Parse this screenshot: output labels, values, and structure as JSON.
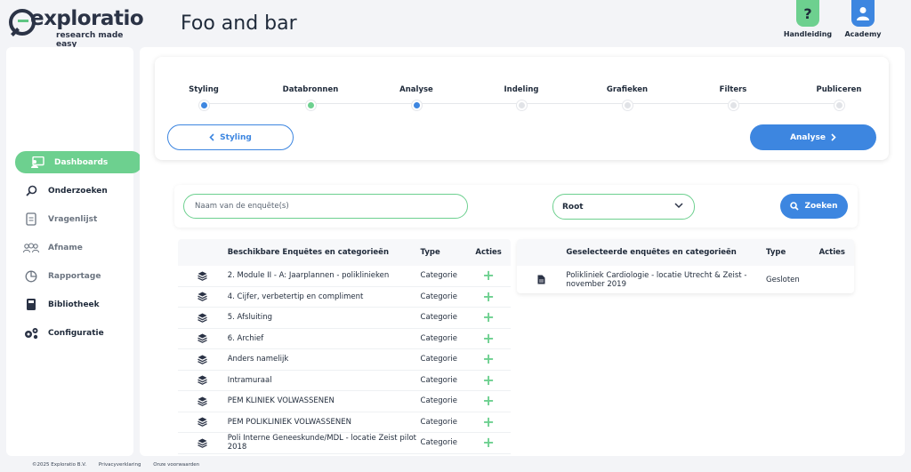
{
  "brand": {
    "logo_word": "exploratio",
    "logo_tagline": "research made easy"
  },
  "app_title": "Foo and bar",
  "header_buttons": [
    {
      "label": "Handleiding",
      "icon": "question-icon",
      "glyph": "?"
    },
    {
      "label": "Academy",
      "icon": "user-icon",
      "glyph": ""
    }
  ],
  "sidebar": {
    "items": [
      {
        "label": "Dashboards",
        "icon": "dashboard-icon",
        "active": true
      },
      {
        "label": "Onderzoeken",
        "icon": "search-icon",
        "active": false
      },
      {
        "label": "Vragenlijst",
        "icon": "document-icon",
        "active": false
      },
      {
        "label": "Afname",
        "icon": "users-icon",
        "active": false
      },
      {
        "label": "Rapportage",
        "icon": "chart-pie-icon",
        "active": false
      },
      {
        "label": "Bibliotheek",
        "icon": "library-icon",
        "active": false
      },
      {
        "label": "Configuratie",
        "icon": "gears-icon",
        "active": false
      }
    ]
  },
  "stepper": {
    "steps": [
      {
        "label": "Styling",
        "state": "done-blue"
      },
      {
        "label": "Databronnen",
        "state": "done-green"
      },
      {
        "label": "Analyse",
        "state": "current"
      },
      {
        "label": "Indeling",
        "state": "todo"
      },
      {
        "label": "Grafieken",
        "state": "todo"
      },
      {
        "label": "Filters",
        "state": "todo"
      },
      {
        "label": "Publiceren",
        "state": "todo"
      }
    ],
    "prev_label": "Styling",
    "next_label": "Analyse"
  },
  "search": {
    "placeholder": "Naam van de enquête(s)",
    "select_value": "Root",
    "button_label": "Zoeken"
  },
  "available_table": {
    "headers": {
      "name": "Beschikbare Enquêtes en categorieën",
      "type": "Type",
      "actions": "Acties"
    },
    "rows": [
      {
        "name": "2. Module II - A: Jaarplannen - poliklinieken",
        "type": "Categorie"
      },
      {
        "name": "4. Cijfer, verbetertip en compliment",
        "type": "Categorie"
      },
      {
        "name": "5. Afsluiting",
        "type": "Categorie"
      },
      {
        "name": "6. Archief",
        "type": "Categorie"
      },
      {
        "name": "Anders namelijk",
        "type": "Categorie"
      },
      {
        "name": "Intramuraal",
        "type": "Categorie"
      },
      {
        "name": "PEM KLINIEK VOLWASSENEN",
        "type": "Categorie"
      },
      {
        "name": "PEM POLIKLINIEK VOLWASSENEN",
        "type": "Categorie"
      },
      {
        "name": "Poli Interne Geneeskunde/MDL - locatie Zeist pilot 2018",
        "type": "Categorie"
      }
    ]
  },
  "selected_table": {
    "headers": {
      "name": "Geselecteerde enquêtes en categorieën",
      "type": "Type",
      "actions": "Acties"
    },
    "rows": [
      {
        "name": "Polikliniek Cardiologie - locatie Utrecht & Zeist - november 2019",
        "type": "Gesloten"
      }
    ]
  },
  "footer": {
    "copyright": "©2025 Exploratio B.V.",
    "privacy": "Privacyverklaring",
    "terms": "Onze voorwaarden"
  },
  "colors": {
    "accent_blue": "#3d86e0",
    "accent_green": "#6dd08f",
    "dark": "#1f2a3a"
  }
}
